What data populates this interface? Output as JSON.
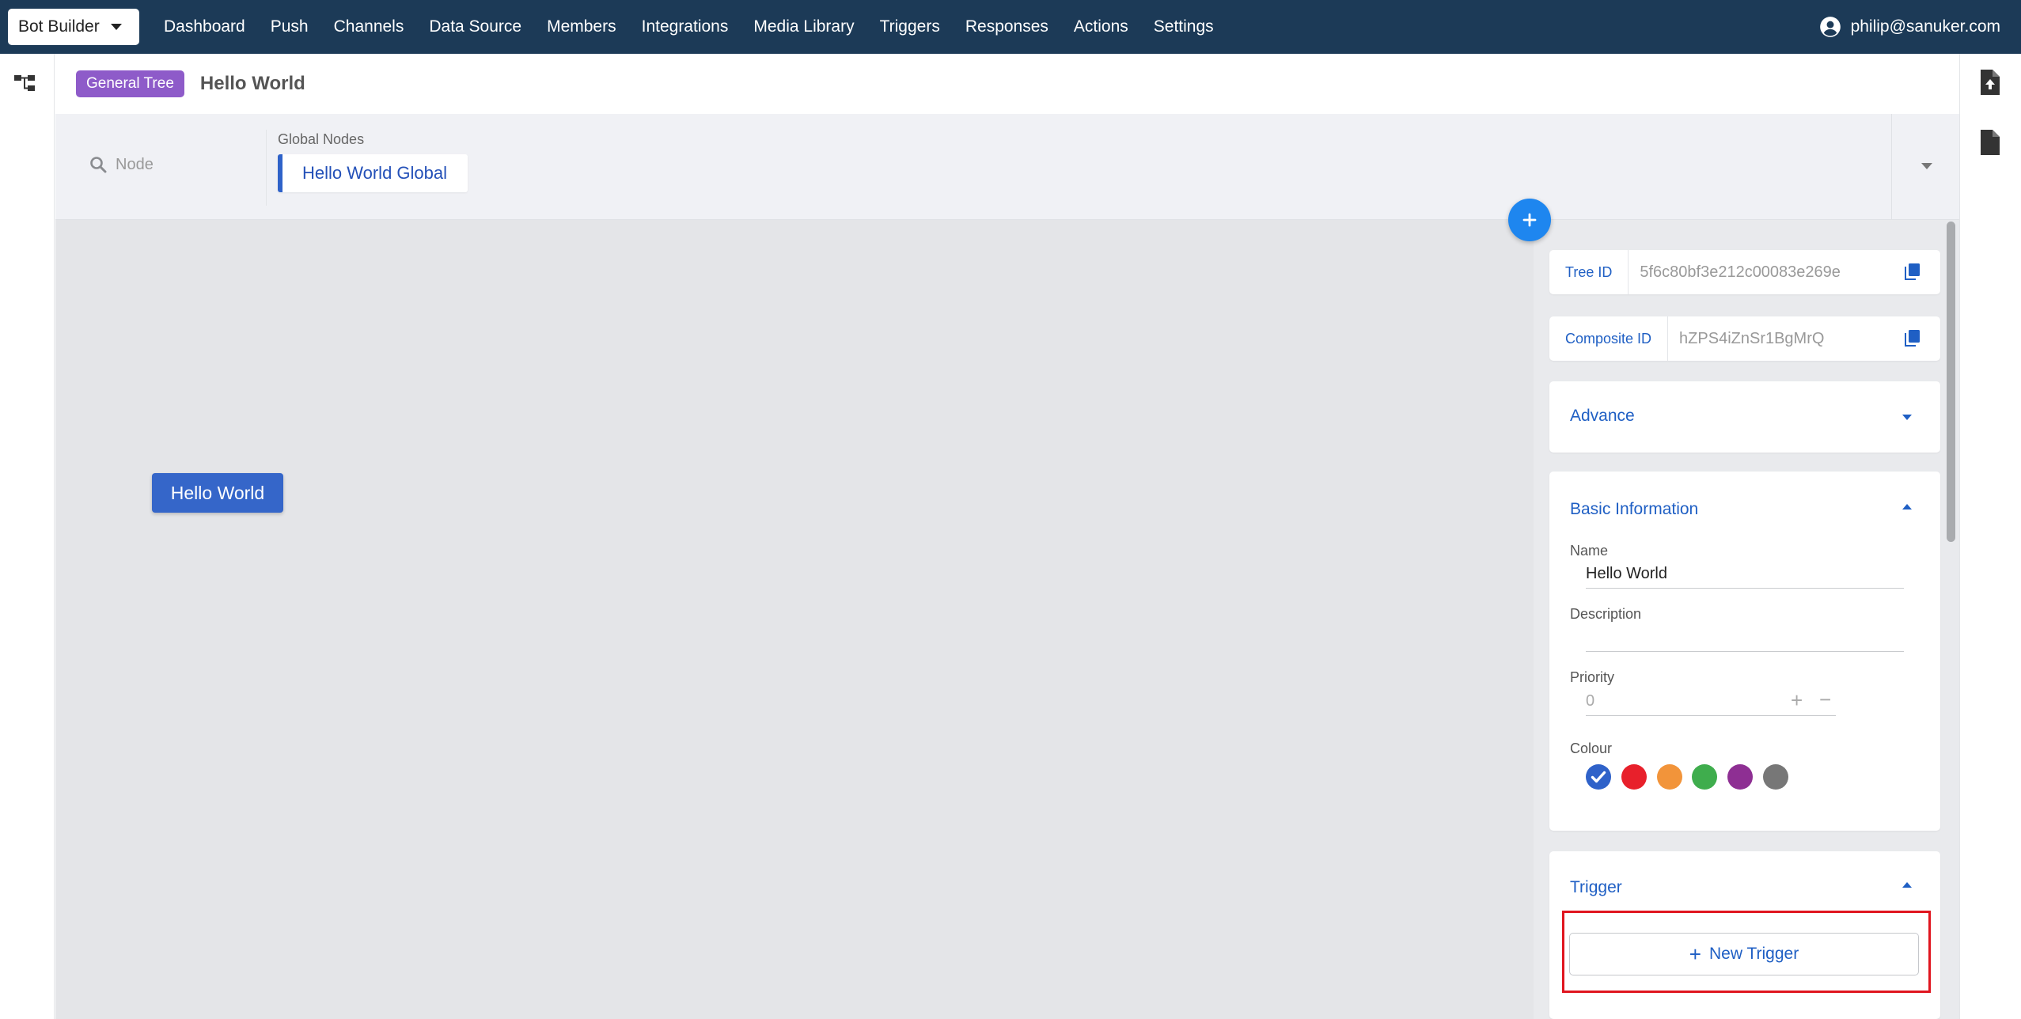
{
  "navbar": {
    "app_switch": "Bot Builder",
    "items": [
      "Dashboard",
      "Push",
      "Channels",
      "Data Source",
      "Members",
      "Integrations",
      "Media Library",
      "Triggers",
      "Responses",
      "Actions",
      "Settings"
    ],
    "user_email": "philip@sanuker.com"
  },
  "header": {
    "badge": "General Tree",
    "title": "Hello World"
  },
  "global_bar": {
    "search_placeholder": "Node",
    "global_nodes_label": "Global Nodes",
    "global_node": "Hello World Global"
  },
  "canvas": {
    "node_label": "Hello World"
  },
  "panel": {
    "tree_id_label": "Tree ID",
    "tree_id_value": "5f6c80bf3e212c00083e269e",
    "composite_id_label": "Composite ID",
    "composite_id_value": "hZPS4iZnSr1BgMrQ",
    "advance_title": "Advance",
    "basic_info_title": "Basic Information",
    "name_label": "Name",
    "name_value": "Hello World",
    "description_label": "Description",
    "description_value": "",
    "priority_label": "Priority",
    "priority_value": "0",
    "plus_symbol": "+",
    "minus_symbol": "−",
    "colour_label": "Colour",
    "colours": [
      "#2f62c9",
      "#e8202b",
      "#f2943a",
      "#3fad4d",
      "#8e2f93",
      "#777777"
    ],
    "selected_colour": "#2f62c9",
    "trigger_title": "Trigger",
    "new_trigger_label": "New Trigger"
  }
}
